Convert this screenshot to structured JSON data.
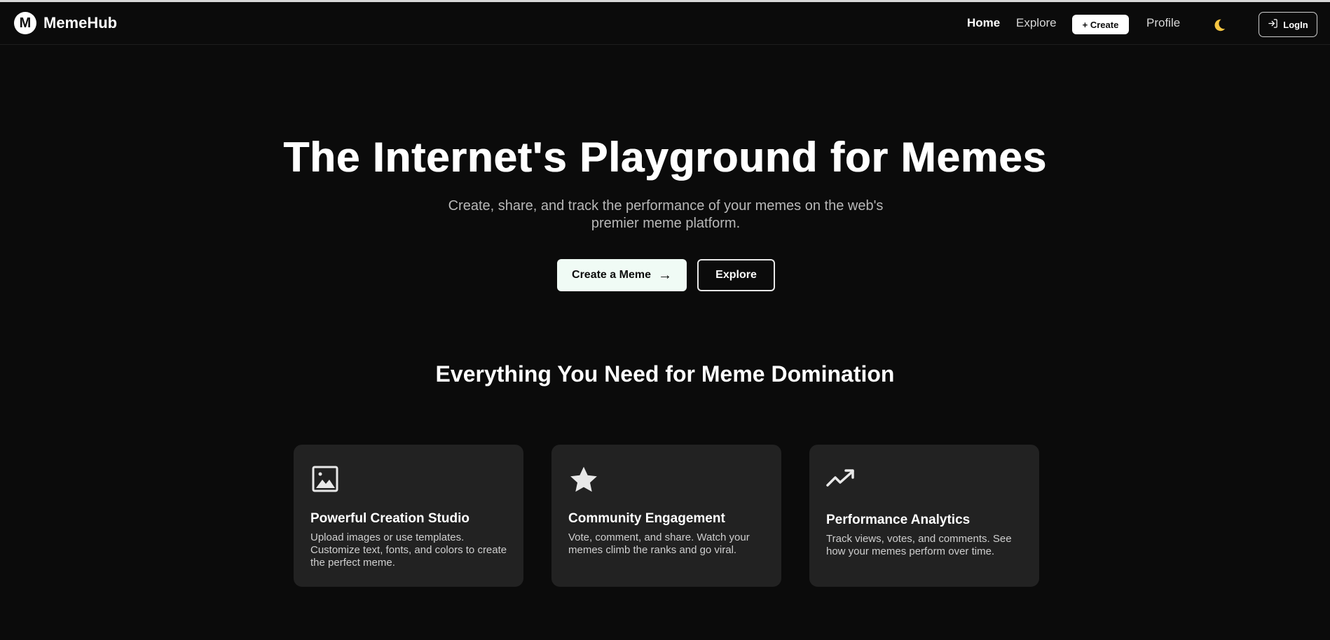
{
  "brand": {
    "logo_letter": "M",
    "name": "MemeHub"
  },
  "nav": {
    "home": "Home",
    "explore": "Explore",
    "create": "+ Create",
    "profile": "Profile",
    "theme_icon": "moon-icon",
    "login": "LogIn"
  },
  "hero": {
    "title": "The Internet's Playground for Memes",
    "subtitle": "Create, share, and track the performance of your memes on the web's premier meme platform.",
    "primary_cta": "Create a Meme",
    "primary_arrow": "→",
    "secondary_cta": "Explore"
  },
  "features": {
    "heading": "Everything You Need for Meme Domination",
    "cards": [
      {
        "icon": "image-icon",
        "title": "Powerful Creation Studio",
        "desc": "Upload images or use templates. Customize text, fonts, and colors to create the perfect meme."
      },
      {
        "icon": "star-icon",
        "title": "Community Engagement",
        "desc": "Vote, comment, and share. Watch your memes climb the ranks and go viral."
      },
      {
        "icon": "trending-up-icon",
        "title": "Performance Analytics",
        "desc": "Track views, votes, and comments. See how your memes perform over time."
      }
    ]
  },
  "colors": {
    "background": "#0b0b0b",
    "card": "#222222",
    "text": "#ffffff",
    "muted": "#b8b8b8",
    "moon": "#f5c542"
  }
}
